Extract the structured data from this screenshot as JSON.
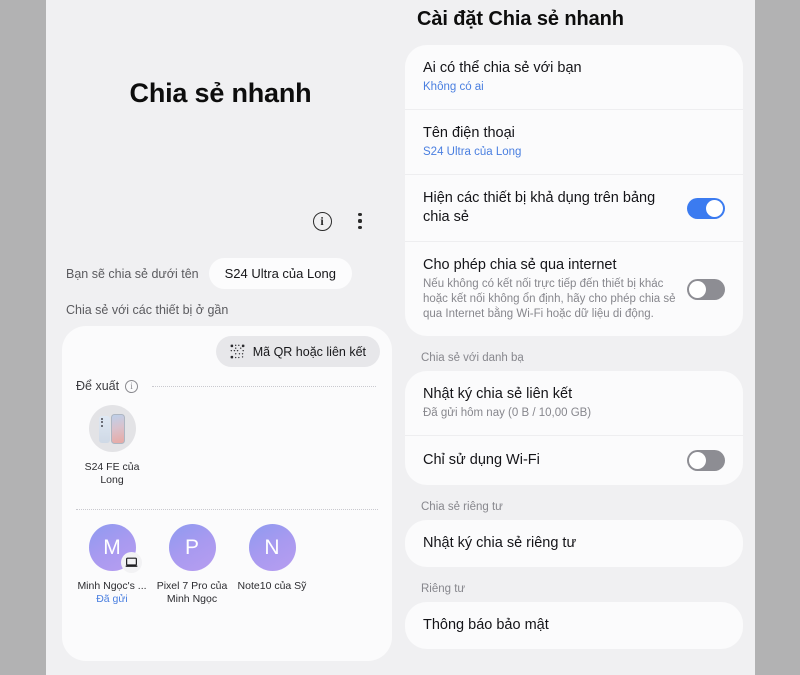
{
  "left": {
    "title": "Chia sẻ nhanh",
    "info_icon": "info-icon",
    "more_icon": "more-vertical-icon",
    "share_as_label": "Bạn sẽ chia sẻ dưới tên",
    "share_as_value": "S24 Ultra của Long",
    "nearby_label": "Chia sẻ với các thiết bị ở gần",
    "qr_button": "Mã QR hoặc liên kết",
    "qr_icon": "qr-code-icon",
    "suggest_label": "Để xuất",
    "suggest_info_icon": "info-icon",
    "suggested_devices": [
      {
        "name": "S24 FE của Long",
        "avatar_type": "phone",
        "status": ""
      }
    ],
    "contact_devices": [
      {
        "initial": "M",
        "name": "Minh Ngọc's ...",
        "status": "Đã gửi",
        "badge_icon": "laptop-icon"
      },
      {
        "initial": "P",
        "name": "Pixel 7 Pro của Minh Ngọc",
        "status": "",
        "badge_icon": ""
      },
      {
        "initial": "N",
        "name": "Note10 của Sỹ",
        "status": "",
        "badge_icon": ""
      }
    ]
  },
  "settings": {
    "title": "Cài đặt Chia sẻ nhanh",
    "groups": [
      {
        "label": "",
        "rows": [
          {
            "title": "Ai có thể chia sẻ với bạn",
            "sub": "Không có ai",
            "sub_color": "blue",
            "toggle": null
          },
          {
            "title": "Tên điện thoại",
            "sub": "S24 Ultra của Long",
            "sub_color": "blue",
            "toggle": null
          },
          {
            "title": "Hiện các thiết bị khả dụng trên bảng chia sẻ",
            "sub": "",
            "sub_color": "",
            "toggle": "on"
          },
          {
            "title": "Cho phép chia sẻ qua internet",
            "sub": "Nếu không có kết nối trực tiếp đến thiết bị khác hoặc kết nối không ổn định, hãy cho phép chia sẻ qua Internet bằng Wi-Fi hoặc dữ liệu di động.",
            "sub_color": "gray",
            "toggle": "off"
          }
        ]
      },
      {
        "label": "Chia sẻ với danh bạ",
        "rows": [
          {
            "title": "Nhật ký chia sẻ liên kết",
            "sub": "Đã gửi hôm nay (0 B / 10,00 GB)",
            "sub_color": "gray",
            "toggle": null
          },
          {
            "title": "Chỉ sử dụng Wi-Fi",
            "sub": "",
            "sub_color": "",
            "toggle": "off"
          }
        ]
      },
      {
        "label": "Chia sẻ riêng tư",
        "rows": [
          {
            "title": "Nhật ký chia sẻ riêng tư",
            "sub": "",
            "sub_color": "",
            "toggle": null
          }
        ]
      },
      {
        "label": "Riêng tư",
        "rows": [
          {
            "title": "Thông báo bảo mật",
            "sub": "",
            "sub_color": "",
            "toggle": null
          }
        ]
      }
    ]
  },
  "colors": {
    "accent_blue": "#3b7bf0",
    "link_blue": "#4a7fe0",
    "background": "#f0f0f2",
    "card": "#fbfbfc",
    "frame_gray": "#b2b2b3"
  }
}
